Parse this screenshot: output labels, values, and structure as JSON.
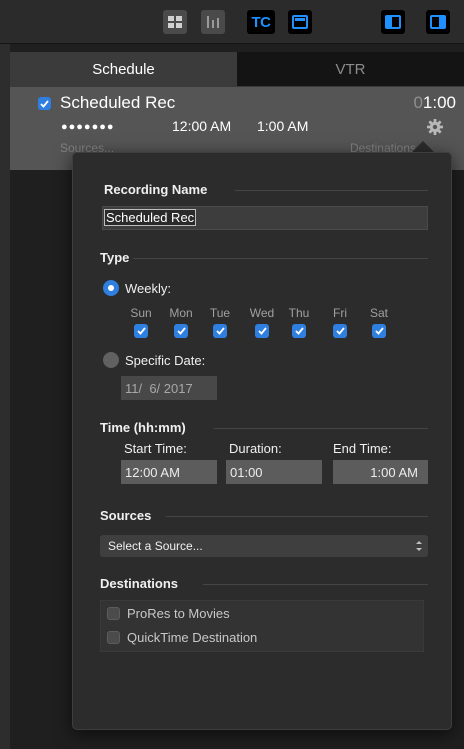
{
  "toolbar": {
    "tc_label": "TC"
  },
  "tabs": {
    "schedule": "Schedule",
    "vtr": "VTR"
  },
  "recording": {
    "name": "Scheduled Rec",
    "duration_dim": "0",
    "duration": "1:00",
    "days": "●●●●●●●",
    "start": "12:00 AM",
    "end": "1:00 AM",
    "sources": "Sources...",
    "destinations": "Destinations"
  },
  "popover": {
    "name_title": "Recording Name",
    "name_value": "Scheduled Rec",
    "type_title": "Type",
    "weekly_label": "Weekly:",
    "days": [
      "Sun",
      "Mon",
      "Tue",
      "Wed",
      "Thu",
      "Fri",
      "Sat"
    ],
    "specific_label": "Specific Date:",
    "specific_date": "11/  6/ 2017",
    "time_title": "Time (hh:mm)",
    "start_label": "Start Time:",
    "start_value": "12:00 AM",
    "duration_label": "Duration:",
    "duration_value": "01:00",
    "end_label": "End Time:",
    "end_value": "1:00 AM",
    "sources_title": "Sources",
    "source_placeholder": "Select a Source...",
    "destinations_title": "Destinations",
    "destinations": [
      "ProRes to Movies",
      "QuickTime Destination"
    ]
  },
  "colors": {
    "accent": "#2f7fe0",
    "background": "#1f1f1f",
    "popover": "#2c2c2c",
    "selected_row": "#555555"
  }
}
